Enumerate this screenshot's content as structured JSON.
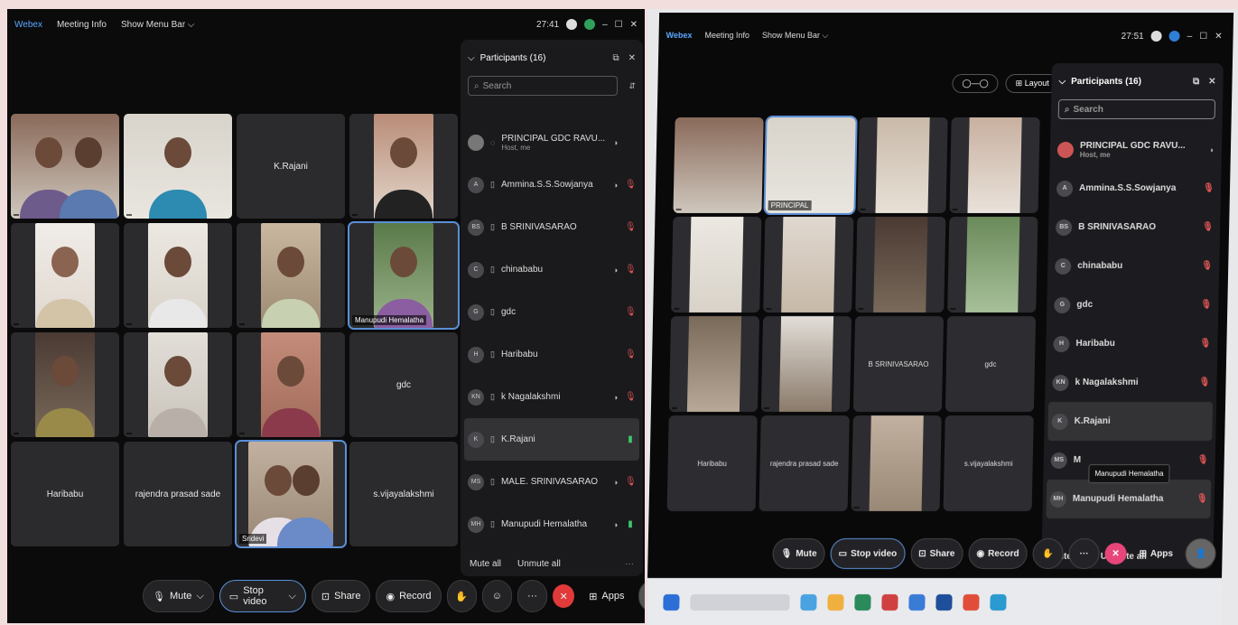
{
  "left": {
    "topbar": {
      "app": "Webex",
      "meeting_info": "Meeting Info",
      "show_menu": "Show Menu Bar ⌵",
      "time": "27:41"
    },
    "tiles": [
      {
        "label": ""
      },
      {
        "label": ""
      },
      {
        "label": "K.Rajani"
      },
      {
        "label": ""
      },
      {
        "label": ""
      },
      {
        "label": ""
      },
      {
        "label": ""
      },
      {
        "label": "Manupudi Hemalatha"
      },
      {
        "label": ""
      },
      {
        "label": ""
      },
      {
        "label": ""
      },
      {
        "label": "gdc"
      },
      {
        "label": "Haribabu"
      },
      {
        "label": "rajendra prasad sade"
      },
      {
        "label": "Sridevi"
      },
      {
        "label": "s.vijayalakshmi"
      }
    ],
    "panel": {
      "title": "Participants (16)",
      "search_placeholder": "Search",
      "participants": [
        {
          "initials": "",
          "name": "PRINCIPAL GDC RAVU...",
          "sub": "Host, me",
          "mic": "none"
        },
        {
          "initials": "A",
          "name": "Ammina.S.S.Sowjanya",
          "sub": "",
          "mic": "red"
        },
        {
          "initials": "BS",
          "name": "B SRINIVASARAO",
          "sub": "",
          "mic": "red"
        },
        {
          "initials": "C",
          "name": "chinababu",
          "sub": "",
          "mic": "red"
        },
        {
          "initials": "G",
          "name": "gdc",
          "sub": "",
          "mic": "red"
        },
        {
          "initials": "H",
          "name": "Haribabu",
          "sub": "",
          "mic": "red"
        },
        {
          "initials": "KN",
          "name": "k Nagalakshmi",
          "sub": "",
          "mic": "red"
        },
        {
          "initials": "K",
          "name": "K.Rajani",
          "sub": "",
          "mic": "green"
        },
        {
          "initials": "MS",
          "name": "MALE. SRINIVASARAO",
          "sub": "",
          "mic": "red"
        },
        {
          "initials": "MH",
          "name": "Manupudi Hemalatha",
          "sub": "",
          "mic": "green"
        }
      ],
      "mute_all": "Mute all",
      "unmute_all": "Unmute all"
    },
    "controls": {
      "mute": "Mute",
      "stop_video": "Stop video",
      "share": "Share",
      "record": "Record",
      "apps": "Apps"
    }
  },
  "right": {
    "topbar": {
      "app": "Webex",
      "meeting_info": "Meeting Info",
      "show_menu": "Show Menu Bar ⌵",
      "time": "27:51"
    },
    "layout_label": "Layout",
    "tiles": [
      {
        "label": ""
      },
      {
        "label": "PRINCIPAL"
      },
      {
        "label": ""
      },
      {
        "label": ""
      },
      {
        "label": ""
      },
      {
        "label": ""
      },
      {
        "label": ""
      },
      {
        "label": ""
      },
      {
        "label": ""
      },
      {
        "label": ""
      },
      {
        "label": "B SRINIVASARAO"
      },
      {
        "label": "gdc"
      },
      {
        "label": "Haribabu"
      },
      {
        "label": "rajendra prasad sade"
      },
      {
        "label": ""
      },
      {
        "label": "s.vijayalakshmi"
      }
    ],
    "panel": {
      "title": "Participants (16)",
      "search_placeholder": "Search",
      "participants": [
        {
          "name": "PRINCIPAL GDC RAVU...",
          "sub": "Host, me"
        },
        {
          "name": "Ammina.S.S.Sowjanya",
          "sub": ""
        },
        {
          "name": "B SRINIVASARAO",
          "sub": ""
        },
        {
          "name": "chinababu",
          "sub": ""
        },
        {
          "name": "gdc",
          "sub": ""
        },
        {
          "name": "Haribabu",
          "sub": ""
        },
        {
          "name": "k Nagalakshmi",
          "sub": ""
        },
        {
          "name": "K.Rajani",
          "sub": ""
        },
        {
          "name": "M",
          "sub": ""
        },
        {
          "name": "Manupudi Hemalatha",
          "sub": ""
        }
      ],
      "tooltip": "Manupudi Hemalatha",
      "mute_all": "Mute all",
      "unmute_all": "Unmute all"
    },
    "controls": {
      "mute": "Mute",
      "stop_video": "Stop video",
      "share": "Share",
      "record": "Record",
      "apps": "Apps"
    }
  }
}
